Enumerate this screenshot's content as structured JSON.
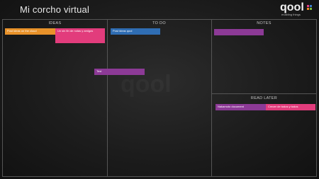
{
  "app": {
    "title": "Mi corcho virtual"
  },
  "logo": {
    "word": "qool",
    "tagline": "enabling things",
    "colors": [
      "#e53a8a",
      "#3a7cc9",
      "#f08a24",
      "#7dbb3c"
    ]
  },
  "watermark": "qool",
  "columns": {
    "ideas": {
      "title": "IDEAS"
    },
    "todo": {
      "title": "TO DO"
    },
    "notes": {
      "title": "NOTES"
    },
    "read_later": {
      "title": "READ LATER"
    }
  },
  "notes": [
    {
      "text": "Post ideas on the cloud",
      "color": "#e8922a"
    },
    {
      "text": "Un sin fin de notas y amigos",
      "color": "#e23c7c"
    },
    {
      "text": "Post ideas qool",
      "color": "#2f6db3"
    },
    {
      "text": "",
      "color": "#8c3a96"
    },
    {
      "text": "Test",
      "color": "#8c3a96"
    },
    {
      "text": "Nakamoto document",
      "color": "#8c3a96"
    },
    {
      "text": "Crecer de todos y todos",
      "color": "#e23c7c"
    }
  ]
}
